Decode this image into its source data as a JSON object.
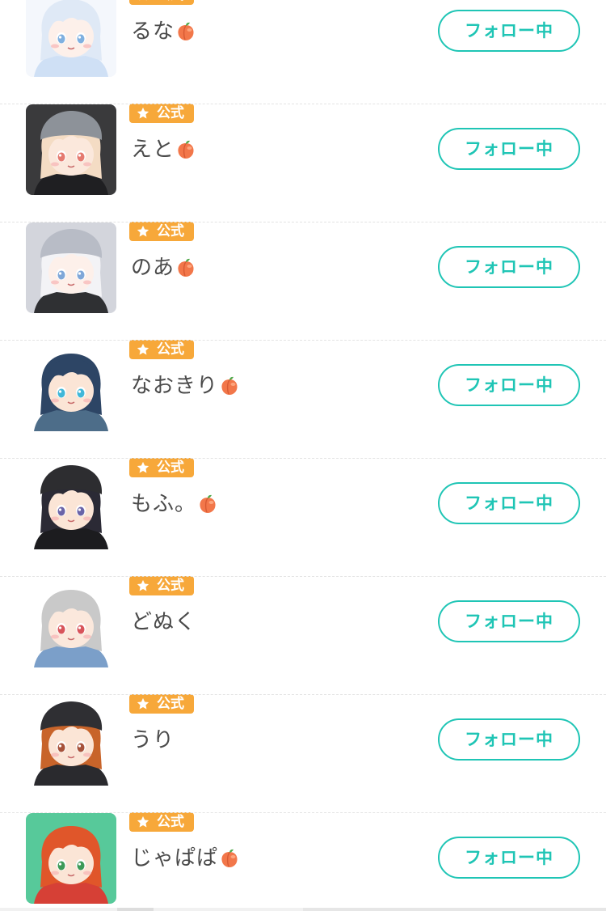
{
  "badge_label": "公式",
  "follow_label": "フォロー中",
  "colors": {
    "accent": "#1fc5b5",
    "badge": "#f7a83a",
    "name_text": "#4a4a4a"
  },
  "users": [
    {
      "name": "るな",
      "peach": true,
      "hair": "#dfe9f6",
      "skin": "#fdf0ea",
      "eye": "#7fb0e0",
      "bg": "#f4f7fc",
      "hat": "",
      "cloth": "#cfe0f5"
    },
    {
      "name": "えと",
      "peach": true,
      "hair": "#f4dcc4",
      "skin": "#fbe8dc",
      "eye": "#e57a70",
      "bg": "#3a3a3c",
      "hat": "#8d9299",
      "cloth": "#1f1f22"
    },
    {
      "name": "のあ",
      "peach": true,
      "hair": "#f3f3f6",
      "skin": "#fdf0ea",
      "eye": "#7fa7d8",
      "bg": "#d3d5dc",
      "hat": "#b8bcc6",
      "cloth": "#2f3033"
    },
    {
      "name": "なおきり",
      "peach": true,
      "hair": "#2d4565",
      "skin": "#fbe5d6",
      "eye": "#40b7d8",
      "bg": "#ffffff",
      "hat": "",
      "cloth": "#4d6d89"
    },
    {
      "name": "もふ。",
      "peach": true,
      "hair": "#2b2a35",
      "skin": "#fbe5d6",
      "eye": "#6a64a8",
      "bg": "#ffffff",
      "hat": "#2d2d30",
      "cloth": "#1c1c1f"
    },
    {
      "name": "どぬく",
      "peach": false,
      "hair": "#c9c9c9",
      "skin": "#fbe8dc",
      "eye": "#d8545a",
      "bg": "#ffffff",
      "hat": "",
      "cloth": "#7b9fc9"
    },
    {
      "name": "うり",
      "peach": false,
      "hair": "#c8642a",
      "skin": "#fbe5d6",
      "eye": "#a7523a",
      "bg": "#ffffff",
      "hat": "#2f2f33",
      "cloth": "#2a2a2e"
    },
    {
      "name": "じゃぱぱ",
      "peach": true,
      "hair": "#e0562a",
      "skin": "#fbe5d6",
      "eye": "#3c9a58",
      "bg": "#57c99a",
      "hat": "",
      "cloth": "#d64036"
    }
  ]
}
